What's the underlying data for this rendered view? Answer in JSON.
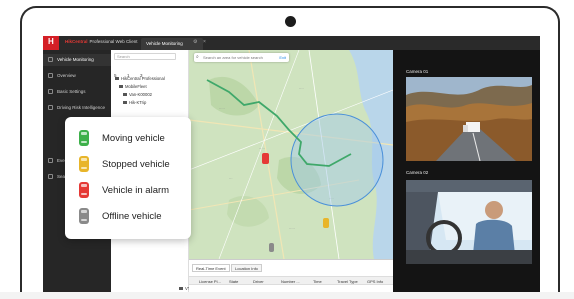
{
  "app": {
    "logo_letter": "H",
    "brand": "HikCentral",
    "title_rest": "Professional Web Client",
    "active_tab": "Vehicle Monitoring",
    "tab_close": "×"
  },
  "sidebar": {
    "items": [
      {
        "label": "Vehicle Monitoring"
      },
      {
        "label": "Overview"
      },
      {
        "label": "Basic Settings"
      },
      {
        "label": "Driving Risk Intelligence"
      },
      {
        "label": "Event"
      },
      {
        "label": "Search"
      }
    ]
  },
  "tree": {
    "search_placeholder": "Search",
    "counts": [
      "5",
      "1",
      "3"
    ],
    "rows": [
      "HikCentral Professional",
      "MobileFleet",
      "Van-K00002",
      "Hik-KTrip",
      "VT Camera 01",
      "VT Camera 02",
      "VT Camera 03",
      "Drive Camera01"
    ]
  },
  "map": {
    "search_placeholder": "Search an area for vehicle search",
    "search_button": "Exit"
  },
  "bottom": {
    "tabs": [
      "Real-Time Event",
      "Location Info"
    ],
    "columns": [
      "License Pl...",
      "State",
      "Driver",
      "Number ...",
      "Time",
      "Travel Type",
      "GPS Info"
    ]
  },
  "cameras": [
    {
      "label": "Camera 01"
    },
    {
      "label": "Camera 02"
    }
  ],
  "legend": {
    "items": [
      {
        "label": "Moving vehicle",
        "color": "#3db04a"
      },
      {
        "label": "Stopped vehicle",
        "color": "#e8b52a"
      },
      {
        "label": "Vehicle in alarm",
        "color": "#e53935"
      },
      {
        "label": "Offline vehicle",
        "color": "#8a8a8a"
      }
    ]
  },
  "colors": {
    "brand_red": "#d41f26",
    "map_land": "#c9dfb8",
    "route": "#3fa86a"
  }
}
